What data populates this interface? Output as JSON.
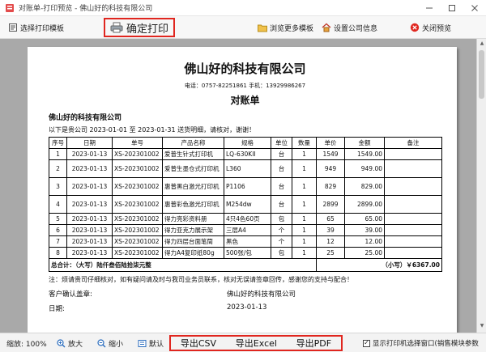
{
  "window": {
    "title": "对账单-打印预览 - 佛山好的科技有限公司"
  },
  "toolbar": {
    "template_label": "选择打印模板",
    "print_label": "确定打印",
    "more_templates_label": "浏览更多模板",
    "company_info_label": "设置公司信息",
    "close_preview_label": "关闭预览"
  },
  "document": {
    "company": "佛山好的科技有限公司",
    "contact": "电话：0757-82251861  手机：13929986267",
    "title": "对账单",
    "customer": "佛山好的科技有限公司",
    "intro": "以下是贵公司 2023-01-01 至 2023-01-31 送货明细，请核对，谢谢！",
    "headers": [
      "序号",
      "日期",
      "单号",
      "产品名称",
      "规格",
      "单位",
      "数量",
      "单价",
      "金额",
      "备注"
    ],
    "rows": [
      {
        "no": "1",
        "date": "2023-01-13",
        "order": "XS-202301002",
        "product": "爱普生针式打印机",
        "spec": "LQ-630KII",
        "unit": "台",
        "qty": "1",
        "price": "1549",
        "amount": "1549.00",
        "remark": ""
      },
      {
        "no": "2",
        "date": "2023-01-13",
        "order": "XS-202301002",
        "product": "爱普生墨仓式打印机",
        "spec": "L360",
        "unit": "台",
        "qty": "1",
        "price": "949",
        "amount": "949.00",
        "remark": ""
      },
      {
        "no": "3",
        "date": "2023-01-13",
        "order": "XS-202301002",
        "product": "惠普黑白激光打印机",
        "spec": "P1106",
        "unit": "台",
        "qty": "1",
        "price": "829",
        "amount": "829.00",
        "remark": ""
      },
      {
        "no": "4",
        "date": "2023-01-13",
        "order": "XS-202301002",
        "product": "惠普彩色激光打印机",
        "spec": "M254dw",
        "unit": "台",
        "qty": "1",
        "price": "2899",
        "amount": "2899.00",
        "remark": ""
      },
      {
        "no": "5",
        "date": "2023-01-13",
        "order": "XS-202301002",
        "product": "得力亮彩资料册",
        "spec": "4只4色60页",
        "unit": "包",
        "qty": "1",
        "price": "65",
        "amount": "65.00",
        "remark": ""
      },
      {
        "no": "6",
        "date": "2023-01-13",
        "order": "XS-202301002",
        "product": "得力亚克力展示架",
        "spec": "三层A4",
        "unit": "个",
        "qty": "1",
        "price": "39",
        "amount": "39.00",
        "remark": ""
      },
      {
        "no": "7",
        "date": "2023-01-13",
        "order": "XS-202301002",
        "product": "得力四层台面笔筒",
        "spec": "黑色",
        "unit": "个",
        "qty": "1",
        "price": "12",
        "amount": "12.00",
        "remark": ""
      },
      {
        "no": "8",
        "date": "2023-01-13",
        "order": "XS-202301002",
        "product": "得力A4复印纸80g",
        "spec": "500张/包",
        "unit": "包",
        "qty": "1",
        "price": "25",
        "amount": "25.00",
        "remark": ""
      }
    ],
    "total_label": "总合计：（大写）陆仟叁佰陆拾柒元整",
    "total_small": "（小写）￥6367.00",
    "note": "注：烦请贵司仔细核对，如有疑问请及时与我司业务员联系，核对无误请签章回传，感谢您的支持与配合！",
    "sign_label": "客户确认盖章:",
    "sign_company": "佛山好的科技有限公司",
    "date_label": "日期:",
    "date_value": "2023-01-13"
  },
  "statusbar": {
    "zoom_label": "缩放: 100%",
    "zoom_in_label": "放大",
    "zoom_out_label": "缩小",
    "default_label": "默认",
    "export_csv": "导出CSV",
    "export_excel": "导出Excel",
    "export_pdf": "导出PDF",
    "show_printer_label": "显示打印机选择窗口(销售模块参数"
  },
  "colors": {
    "highlight": "#e0261f",
    "canvas": "#a9a9a9"
  }
}
